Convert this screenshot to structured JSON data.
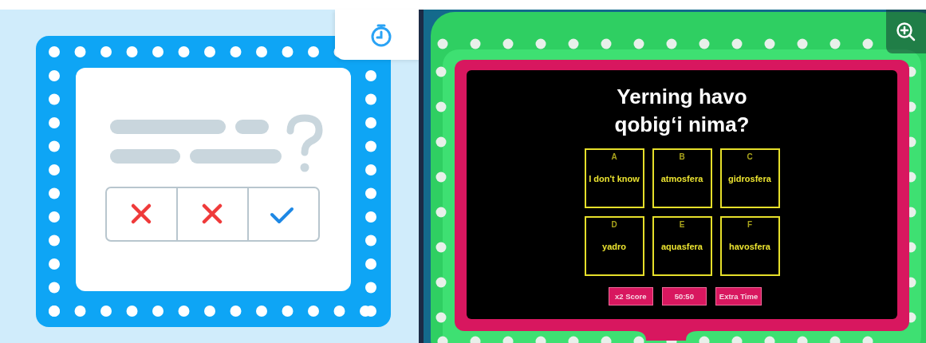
{
  "question": "Yerning havo qobig‘i nima?",
  "answers": [
    {
      "letter": "A",
      "text": "I don't know"
    },
    {
      "letter": "B",
      "text": "atmosfera"
    },
    {
      "letter": "C",
      "text": "gidrosfera"
    },
    {
      "letter": "D",
      "text": "yadro"
    },
    {
      "letter": "E",
      "text": "aquasfera"
    },
    {
      "letter": "F",
      "text": "havosfera"
    }
  ],
  "powerups": [
    "x2 Score",
    "50:50",
    "Extra Time"
  ]
}
